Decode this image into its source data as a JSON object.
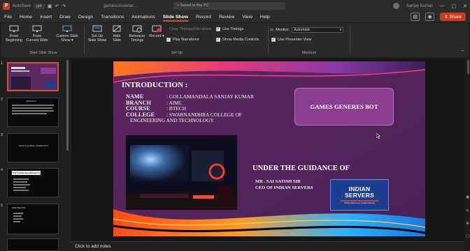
{
  "titlebar": {
    "autosave": "AutoSave",
    "file_pill": "ppt",
    "doc_name": "gamesconcerter...",
    "search_placeholder": "Saved to this PC",
    "user_name": "Sanjay Kumar",
    "minimize_glyph": "—",
    "maximize_glyph": "▢",
    "close_glyph": "✕"
  },
  "menu": {
    "tabs": [
      "File",
      "Home",
      "Insert",
      "Draw",
      "Design",
      "Transitions",
      "Animations",
      "Slide Show",
      "Record",
      "Review",
      "View",
      "Help"
    ],
    "active_tab": "Slide Show",
    "share_label": "Share"
  },
  "ribbon": {
    "start_group_label": "Start Slide Show",
    "from_beginning": [
      "From",
      "Beginning"
    ],
    "from_current": [
      "From",
      "Current Slide"
    ],
    "custom_show": [
      "Custom Slide",
      "Show ▾"
    ],
    "setup_group_label": "Set Up",
    "setup_show": [
      "Set Up",
      "Slide Show"
    ],
    "hide_slide": [
      "Hide",
      "Slide"
    ],
    "rehearse": [
      "Rehearse",
      "Timings"
    ],
    "record": [
      "Record",
      ""
    ],
    "clear_timings": "Clear Timings/Narrations",
    "play_narrations": "Play Narrations",
    "use_timings": "Use Timings",
    "show_media_controls": "Show Media Controls",
    "monitors_group_label": "Monitors",
    "monitor_label": "Monitor:",
    "monitor_value": "Automatic",
    "presenter_view": "Use Presenter View"
  },
  "thumbnails": {
    "numbers": [
      "1",
      "2",
      "3",
      "4",
      "5"
    ],
    "t2_title": "ABSTRACT",
    "t3_title": "WHAT IS GAMING GENRES BOT",
    "t4_title": "SOFTWARE REQUIREMENTS",
    "t5_title": "EXISTING SYS"
  },
  "slide": {
    "title": "INTRODUCTION :",
    "rows": [
      {
        "key": "NAME",
        "value": ": GOLLAMANDALA SANJAY KUMAR"
      },
      {
        "key": "BRANCH",
        "value": ": AIML"
      },
      {
        "key": "COURSE",
        "value": ": BTECH"
      },
      {
        "key": "COLLEGE",
        "value": ": SWARNANDHRA COLLEGE OF"
      }
    ],
    "college_wrap": "ENGINEERING AND TECHNOLOGY",
    "project_title": "GAMES GENERES BOT",
    "guidance_heading": "UNDER THE GUIDANCE OF",
    "guide_name": "MR . SAI SATISH SIR",
    "guide_role": "CEO OF INDIAN SERVERS",
    "logo_line1": "INDIAN",
    "logo_line2": "SERVERS",
    "logo_small": "Website Maintenance & Digital Marketing"
  },
  "notes_placeholder": "Click to add notes",
  "colors": {
    "accent": "#d35230",
    "share": "#c43e1c",
    "slide_bg": "#55245a",
    "title_box": "#8b3d8f",
    "logo_blue": "#1b3e91"
  }
}
